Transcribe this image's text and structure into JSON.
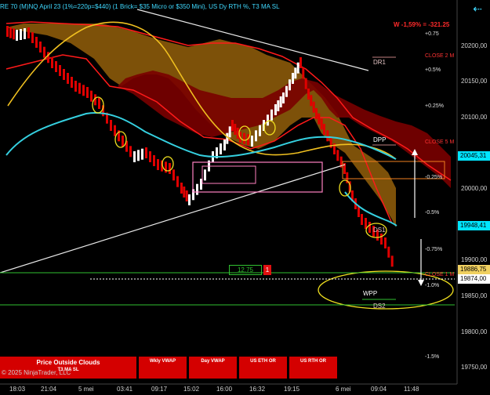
{
  "header": {
    "title": "RE 70 (M)NQ April 23 (1%=220p=$440) (1 Brick= $35 Micro or $350 Mini), US Dy RTH %, T3 MA SL",
    "collapse_icon": "arrow-left-icon"
  },
  "pnl_label": "W -1,59% = -321.25",
  "price_axis": [
    "20200,00",
    "20150,00",
    "20100,00",
    "20000,00",
    "19900,00",
    "19850,00",
    "19800,00",
    "19750,00"
  ],
  "price_tags": {
    "cyan_top": "20045,31",
    "cyan_mid": "19948,41",
    "gold": "19886,75",
    "white": "19874,00"
  },
  "percent_labels": {
    "p075": "+0.75",
    "p05": "+0.5%",
    "p025": "+0.25%",
    "m025": "-0.25%",
    "m05": "-0.5%",
    "m075": "-0.75%",
    "m10": "-1.0%",
    "m15": "-1.5%"
  },
  "close_labels": {
    "c2": "CLOSE 2 M",
    "c5": "CLOSE 5 M",
    "c1": "CLOSE 1 M"
  },
  "levels": {
    "dr1": "DR1",
    "dpp": "DPP",
    "ds1": "DS1",
    "wpp": "WPP",
    "ds2": "DS2"
  },
  "order_box": {
    "price": "12.75",
    "qty": "1"
  },
  "time_axis": [
    "18:03",
    "21:04",
    "5 mei",
    "03:41",
    "09:17",
    "15:02",
    "16:00",
    "16:32",
    "19:15",
    "6 mei",
    "09:04",
    "11:48"
  ],
  "buttons": [
    {
      "line1": "Price Outside Clouds",
      "line2": "T3 MA SL"
    },
    {
      "line1": "Wkly VWAP",
      "line2": ""
    },
    {
      "line1": "Day VWAP",
      "line2": ""
    },
    {
      "line1": "US ETH OR",
      "line2": ""
    },
    {
      "line1": "US RTH OR",
      "line2": ""
    }
  ],
  "copyright": "© 2025 NinjaTrader, LLC",
  "colors": {
    "background": "#000000",
    "up_bar": "#ffffff",
    "down_bar": "#e00000",
    "cloud_bull": "#8b5a0a",
    "cloud_bear": "#7a0000",
    "ma_cyan": "#35d0e0",
    "ma_gold": "#f0c020",
    "trend_line": "#e8e8e8"
  }
}
